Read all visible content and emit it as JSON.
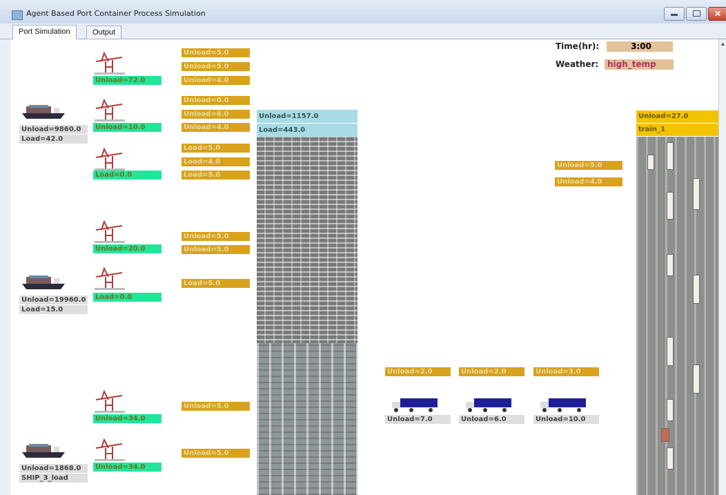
{
  "window": {
    "title": "Agent Based Port Container Process Simulation"
  },
  "tabs": [
    {
      "label": "Port Simulation"
    },
    {
      "label": "Output"
    }
  ],
  "status": {
    "time_label": "Time(hr):",
    "time_value": "3:00",
    "weather_label": "Weather:",
    "weather_value": "high_temp"
  },
  "ships": [
    {
      "unload": "Unload=9860.0",
      "load": "Load=42.0"
    },
    {
      "unload": "Unload=19960.0",
      "load": "Load=15.0"
    },
    {
      "unload": "Unload=1868.0",
      "load": "SHIP_3_load"
    }
  ],
  "cranes": [
    {
      "label": "Unload=72.0"
    },
    {
      "label": "Unload=10.0"
    },
    {
      "label": "Load=0.0"
    },
    {
      "label": "Unload=20.0"
    },
    {
      "label": "Load=0.0"
    },
    {
      "label": "Unload=34.0"
    },
    {
      "label": "Unload=34.0"
    }
  ],
  "crane_tasks": [
    "Unload=5.0",
    "Unload=5.0",
    "Unload=4.0",
    "Unload=0.0",
    "Unload=6.0",
    "Unload=4.0",
    "Load=5.0",
    "Load=4.0",
    "Load=5.0",
    "Unload=5.0",
    "Unload=5.0",
    "Load=5.0",
    "Unload=5.0",
    "Unload=5.0"
  ],
  "yard": {
    "unload": "Unload=1157.0",
    "load": "Load=443.0"
  },
  "mid_tasks": [
    "Unload=5.0",
    "Unload=4.0"
  ],
  "rail": {
    "unload": "Unload=27.0",
    "train": "train_1"
  },
  "truck_tasks": [
    "Unload=2.0",
    "Unload=2.0",
    "Unload=3.0"
  ],
  "trucks": [
    {
      "label": "Unload=7.0"
    },
    {
      "label": "Unload=6.0"
    },
    {
      "label": "Unload=10.0"
    }
  ],
  "colors": {
    "crane": "#21e69a",
    "task": "#d9a21d",
    "yard": "#a9dbe6",
    "rail": "#f2c400",
    "truck": "#1e1e9a"
  }
}
